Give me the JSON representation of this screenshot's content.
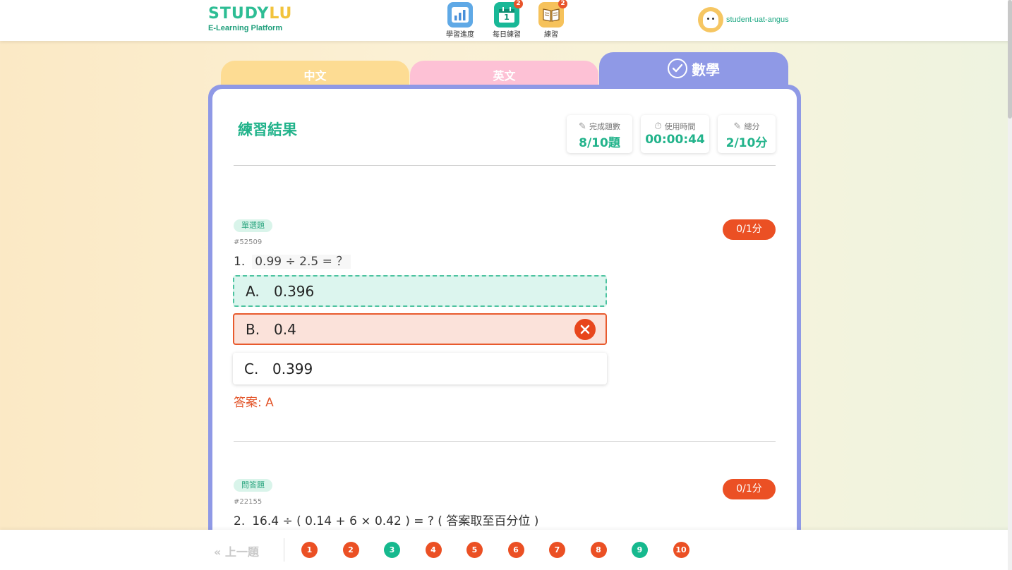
{
  "header": {
    "logo_main_a": "STUDY",
    "logo_main_b": "LU",
    "logo_sub": "E-Learning Platform",
    "nav": [
      {
        "label": "學習進度",
        "icon": "bar-chart-icon"
      },
      {
        "label": "每日練習",
        "icon": "calendar-icon",
        "badge": "2",
        "day": "1"
      },
      {
        "label": "練習",
        "icon": "book-icon",
        "badge": "2"
      }
    ],
    "username": "student-uat-angus"
  },
  "tabs": {
    "chinese": "中文",
    "english": "英文",
    "math": "數學"
  },
  "result": {
    "title": "練習結果",
    "stats": [
      {
        "label": "完成題數",
        "value": "8/10題"
      },
      {
        "label": "使用時間",
        "value": "00:00:44"
      },
      {
        "label": "總分",
        "value": "2/10分"
      }
    ]
  },
  "questions": [
    {
      "type": "單選題",
      "id": "#52509",
      "number": "1.",
      "text": "0.99 ÷ 2.5 = ？",
      "score": "0/1分",
      "options": [
        {
          "letter": "A.",
          "value": "0.396"
        },
        {
          "letter": "B.",
          "value": "0.4"
        },
        {
          "letter": "C.",
          "value": "0.399"
        }
      ],
      "answer": "答案: A"
    },
    {
      "type": "問答題",
      "id": "#22155",
      "number": "2.",
      "text": "16.4 ÷ ( 0.14 + 6 × 0.42 ) = ? ( 答案取至百分位 )",
      "score": "0/1分"
    }
  ],
  "pagination": {
    "prev": "上一題",
    "pages": [
      {
        "n": "1",
        "status": "wrong"
      },
      {
        "n": "2",
        "status": "wrong"
      },
      {
        "n": "3",
        "status": "correct"
      },
      {
        "n": "4",
        "status": "wrong"
      },
      {
        "n": "5",
        "status": "wrong"
      },
      {
        "n": "6",
        "status": "wrong"
      },
      {
        "n": "7",
        "status": "wrong"
      },
      {
        "n": "8",
        "status": "wrong"
      },
      {
        "n": "9",
        "status": "correct"
      },
      {
        "n": "10",
        "status": "wrong"
      }
    ]
  },
  "colors": {
    "brand_green": "#2dbd94",
    "wrong_red": "#eb5024",
    "correct_green": "#16b98e",
    "math_tab": "#8f99e6",
    "chinese_tab": "#fddc93",
    "english_tab": "#fdc1d5"
  }
}
